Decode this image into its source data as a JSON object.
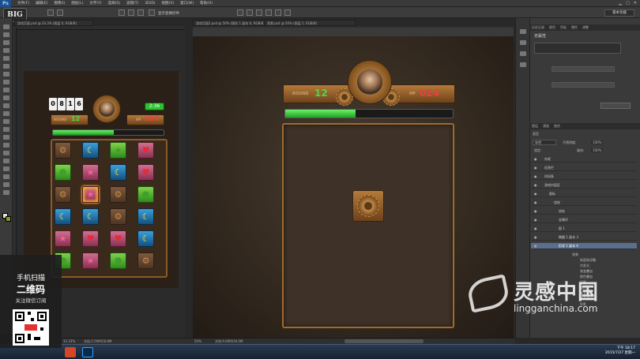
{
  "app": {
    "logo": "Ps"
  },
  "menubar": {
    "items": [
      "文件(F)",
      "编辑(E)",
      "图像(I)",
      "图层(L)",
      "文字(Y)",
      "选择(S)",
      "滤镜(T)",
      "3D(D)",
      "视图(V)",
      "窗口(W)",
      "帮助(H)"
    ]
  },
  "badge": "BIG",
  "optbar": {
    "auto_select_label": "显示变换控件",
    "workspace": "基本功能"
  },
  "tabs": [
    {
      "label": "游戏页面.psd @ 33.3% (图层 0, RGB/8)",
      "close": "×"
    },
    {
      "label": "游戏页面2.psd @ 50% (图形 1 副本 6, RGB/8)",
      "close": "×"
    },
    {
      "label": "背景.psd @ 50% (图层 1, RGB/8)",
      "close": "×"
    }
  ],
  "left_game": {
    "timer_digits": [
      "0",
      "8",
      "1",
      "6"
    ],
    "time_badge": "2:36",
    "round_label": "ROUND",
    "round_value": "12",
    "hp_label": "HP",
    "hp_value": "024",
    "progress": 0.55,
    "board": [
      [
        "gear",
        "moon",
        "star-green",
        "heart"
      ],
      [
        "green",
        "star",
        "moon",
        "heart"
      ],
      [
        "gear",
        "star-glow",
        "gear",
        "green"
      ],
      [
        "moon",
        "moon",
        "gear",
        "moon"
      ],
      [
        "star",
        "heart",
        "heart",
        "moon"
      ],
      [
        "green",
        "star",
        "green",
        "gear"
      ]
    ]
  },
  "mid_game": {
    "round_label": "ROUND",
    "round_value": "12",
    "hp_label": "HP",
    "hp_value": "024",
    "progress": 0.42
  },
  "right_panel": {
    "tabs_top": [
      "历史记录",
      "颜色",
      "色板",
      "属性",
      "调整"
    ],
    "properties_title": "无属性",
    "layers_tabs": [
      "图层",
      "通道",
      "路径"
    ],
    "blend_mode": "穿透",
    "opacity_label": "不透明度:",
    "opacity_value": "100%",
    "fill_label": "填充:",
    "fill_value": "100%",
    "lock_label": "锁定:",
    "kind_label": "类型",
    "layers": [
      {
        "name": "外框",
        "sel": false
      },
      {
        "name": "信息栏",
        "sel": false
      },
      {
        "name": "时间条",
        "sel": false
      },
      {
        "name": "游戏内容区",
        "sel": false
      },
      {
        "name": "图标",
        "sel": false
      },
      {
        "name": "齿轮",
        "sel": false
      },
      {
        "name": "齿轮",
        "sel": false
      },
      {
        "name": "金属环",
        "sel": false
      },
      {
        "name": "图 1",
        "sel": false
      },
      {
        "name": "椭圆 1 副本 3",
        "sel": false
      },
      {
        "name": "形状 1 副本 6",
        "sel": true
      }
    ],
    "fx_rows": [
      "效果",
      "斜面和浮雕",
      "内发光",
      "渐变叠加",
      "颜色叠加",
      "投影",
      "描边",
      "渐变叠加",
      "颜色叠加",
      "投影"
    ]
  },
  "statusbar": {
    "left_zoom": "33.33%",
    "left_doc": "文档:2.59M/28.8M",
    "mid_zoom": "50%",
    "mid_doc": "文档:9.06M/36.0M"
  },
  "qr_overlay": {
    "line1": "手机扫描",
    "line2": "二维码",
    "line3": "关注微信订阅"
  },
  "watermark": {
    "title": "灵感中国",
    "url": "lingganchina.com"
  },
  "clock": {
    "time": "下午 18:17",
    "date": "2015/7/27 星期一"
  },
  "colors": {
    "accent_green": "#3ad03a",
    "hp_red": "#e84040",
    "selection_blue": "#5a6f8e"
  }
}
